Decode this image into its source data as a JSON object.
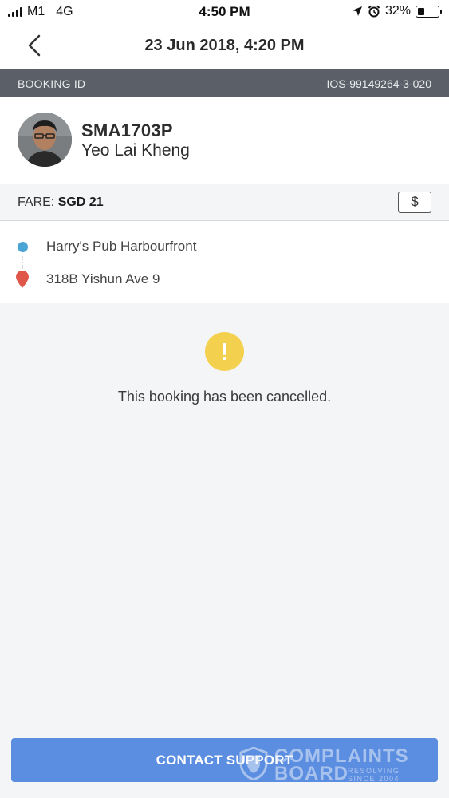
{
  "status_bar": {
    "carrier": "M1",
    "network": "4G",
    "time": "4:50 PM",
    "battery_percent": "32%",
    "battery_level": 0.32,
    "icons": [
      "signal-icon",
      "location-arrow-icon",
      "alarm-icon",
      "battery-icon"
    ]
  },
  "header": {
    "title": "23 Jun 2018, 4:20 PM",
    "back_icon": "chevron-left-icon"
  },
  "booking": {
    "id_label": "BOOKING ID",
    "id_value": "IOS-99149264-3-020"
  },
  "driver": {
    "plate": "SMA1703P",
    "name": "Yeo Lai Kheng",
    "avatar_icon": "avatar"
  },
  "fare": {
    "label": "FARE:",
    "amount": "SGD 21",
    "button_label": "$"
  },
  "route": {
    "pickup": "Harry's Pub Harbourfront",
    "dropoff": "318B Yishun Ave 9"
  },
  "status": {
    "icon_glyph": "!",
    "message": "This booking has been cancelled."
  },
  "actions": {
    "contact_support": "CONTACT SUPPORT"
  },
  "watermark": {
    "line1": "COMPLAINTS",
    "line2": "BOARD",
    "tagline1": "RESOLVING",
    "tagline2": "SINCE 2004"
  },
  "colors": {
    "booking_bar": "#5b6068",
    "pickup": "#4aa4d4",
    "dropoff": "#e0574a",
    "warning": "#f3d14e",
    "primary_button": "#5b8ee0"
  }
}
